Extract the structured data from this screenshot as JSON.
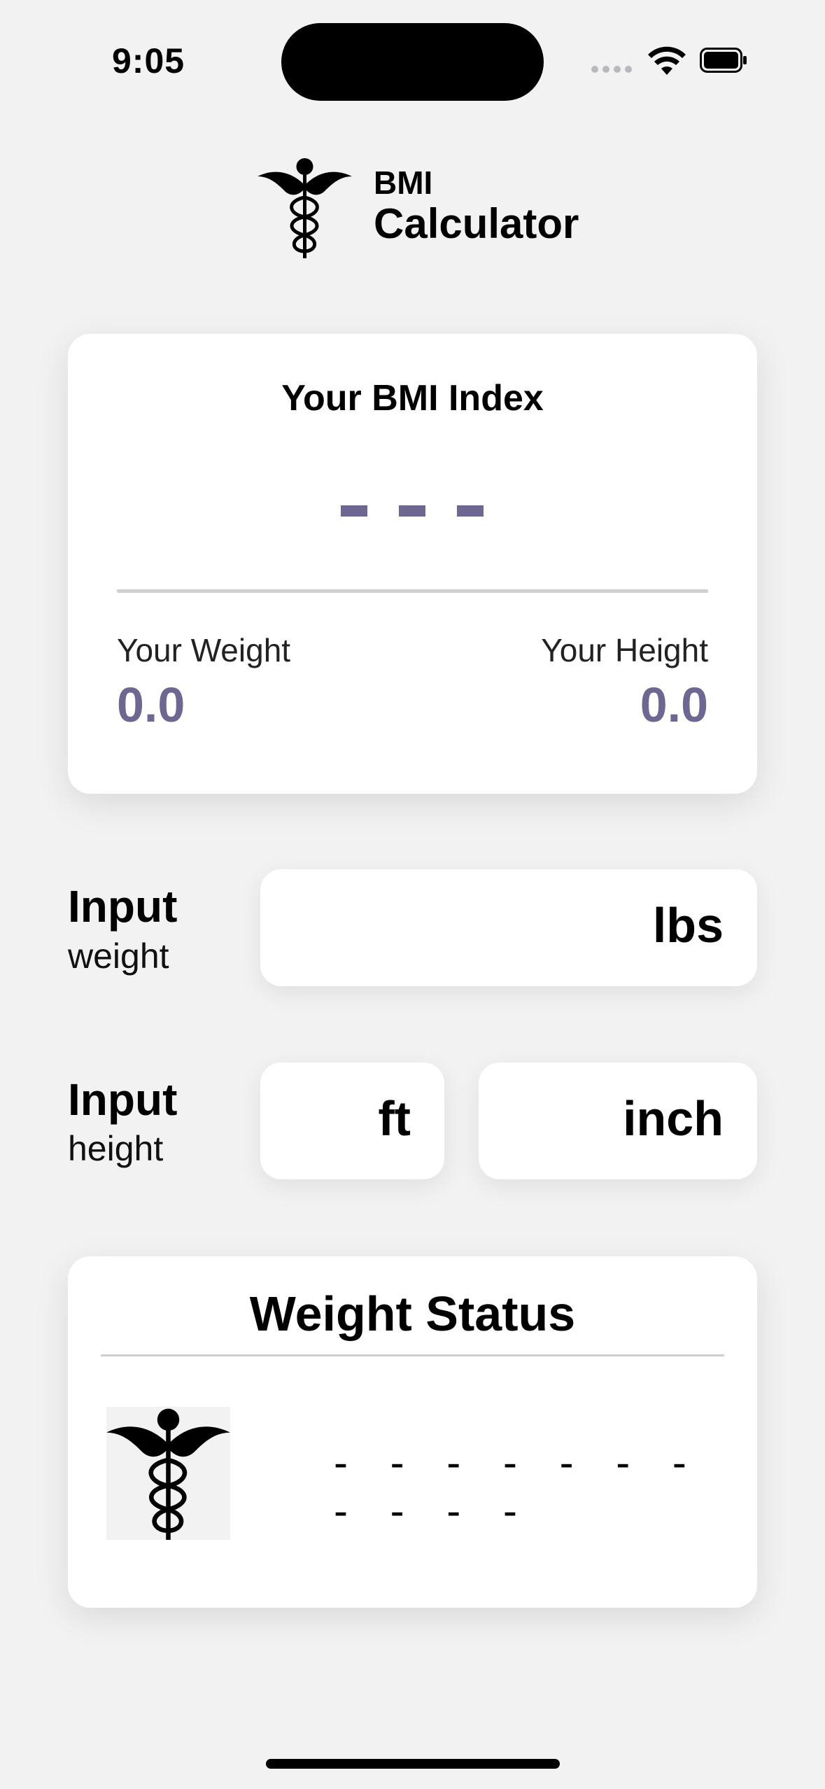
{
  "status_bar": {
    "time": "9:05"
  },
  "header": {
    "title_small": "BMI",
    "title_large": "Calculator"
  },
  "bmi_card": {
    "title": "Your BMI Index",
    "value_placeholder": "- - -",
    "weight_label": "Your Weight",
    "weight_value": "0.0",
    "height_label": "Your Height",
    "height_value": "0.0"
  },
  "weight_input": {
    "label_bold": "Input",
    "label_sub": "weight",
    "unit": "lbs",
    "value": ""
  },
  "height_input": {
    "label_bold": "Input",
    "label_sub": "height",
    "ft_unit": "ft",
    "inch_unit": "inch"
  },
  "status_card": {
    "title": "Weight Status",
    "status_text": "- - - - - - - - - - -"
  },
  "colors": {
    "accent": "#6e6791",
    "background": "#f3f2f3"
  },
  "icons": [
    "caduceus-icon",
    "wifi-icon",
    "battery-icon",
    "signal-icon"
  ]
}
